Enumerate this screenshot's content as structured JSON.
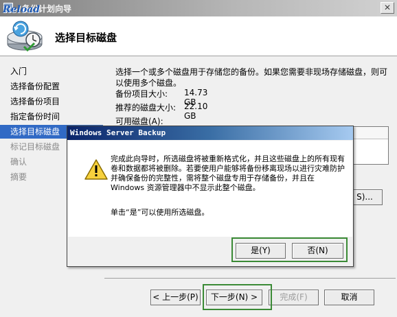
{
  "window": {
    "title": "备份计划向导",
    "watermark": "Reload",
    "close_glyph": "✕"
  },
  "header": {
    "title": "选择目标磁盘",
    "icon": "backup-disk-clock-icon"
  },
  "nav": {
    "items": [
      {
        "label": "入门",
        "state": "done"
      },
      {
        "label": "选择备份配置",
        "state": "done"
      },
      {
        "label": "选择备份项目",
        "state": "done"
      },
      {
        "label": "指定备份时间",
        "state": "done"
      },
      {
        "label": "选择目标磁盘",
        "state": "active"
      },
      {
        "label": "标记目标磁盘",
        "state": "future"
      },
      {
        "label": "确认",
        "state": "future"
      },
      {
        "label": "摘要",
        "state": "future"
      }
    ]
  },
  "main": {
    "description": "选择一个或多个磁盘用于存储您的备份。如果您需要非现场存储磁盘，则可以使用多个磁盘。",
    "backup_size_label": "备份项目大小:",
    "backup_size_value": "14.73 GB",
    "recommended_size_label": "推荐的磁盘大小:",
    "recommended_size_value": "22.10 GB",
    "available_disks_label": "可用磁盘(A):",
    "show_all_button": "S)..."
  },
  "footer": {
    "back_button": "< 上一步(P)",
    "next_button": "下一步(N) >",
    "finish_button": "完成(F)",
    "cancel_button": "取消"
  },
  "dialog": {
    "title": "Windows Server Backup",
    "message": "完成此向导时，所选磁盘将被重新格式化，并且这些磁盘上的所有现有卷和数据都将被删除。若要使用户能够将备份移离现场以进行灾难防护并确保备份的完整性，需将整个磁盘专用于存储备份，并且在 Windows 资源管理器中不显示此整个磁盘。",
    "prompt": "单击“是”可以使用所选磁盘。",
    "yes_button": "是(Y)",
    "no_button": "否(N)"
  },
  "colors": {
    "nav_active": "#316ac5",
    "dialog_title": "#0a246a",
    "highlight": "#3a8a35"
  }
}
